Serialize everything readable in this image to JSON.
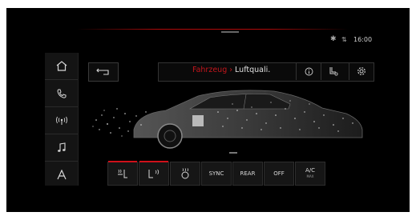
{
  "status": {
    "time": "16:00",
    "bluetooth_icon": "bluetooth-icon",
    "signal_icon": "signal-icon"
  },
  "sidebar": {
    "items": [
      {
        "name": "home",
        "icon": "home-icon"
      },
      {
        "name": "phone",
        "icon": "phone-icon"
      },
      {
        "name": "radio",
        "icon": "radio-antenna-icon"
      },
      {
        "name": "media",
        "icon": "music-note-icon"
      },
      {
        "name": "navigation",
        "icon": "navigation-arrow-icon",
        "label": "A"
      }
    ]
  },
  "header": {
    "breadcrumb_prev": "Fahrzeug",
    "breadcrumb_sep": "›",
    "breadcrumb_current": "Luftquali.",
    "info_icon": "info-icon",
    "seat_icon": "seat-settings-icon",
    "gear_icon": "gear-icon",
    "back_icon": "back-arrow-icon"
  },
  "climate_bar": {
    "buttons": [
      {
        "id": "seat-heat-driver",
        "label": "",
        "icon": "seat-heating-icon",
        "active": true
      },
      {
        "id": "seat-vent-driver",
        "label": "",
        "icon": "seat-ventilation-icon",
        "active": true
      },
      {
        "id": "steering-heat",
        "label": "",
        "icon": "steering-heating-icon",
        "active": false
      },
      {
        "id": "sync",
        "label": "SYNC",
        "active": false
      },
      {
        "id": "rear",
        "label": "REAR",
        "active": false
      },
      {
        "id": "off",
        "label": "OFF",
        "active": false
      },
      {
        "id": "ac",
        "label": "A/C",
        "sub": "MAX",
        "active": false
      }
    ],
    "accent_color": "#d0111a"
  },
  "colors": {
    "accent": "#c4161c",
    "background": "#000000"
  }
}
